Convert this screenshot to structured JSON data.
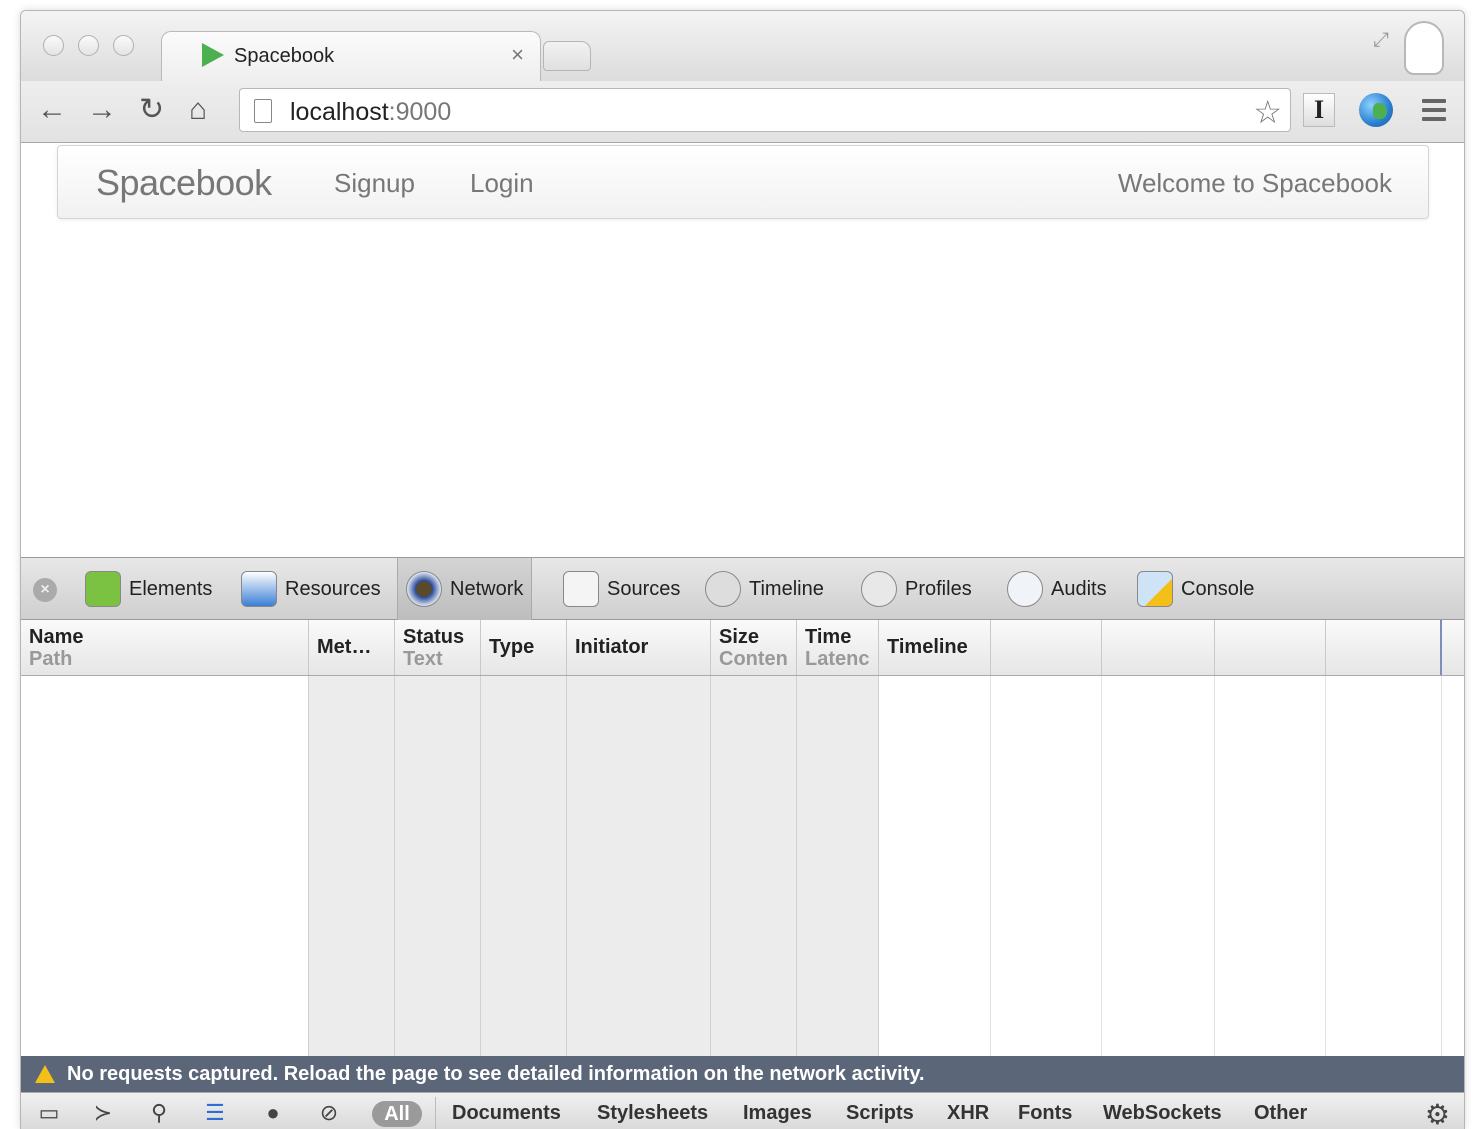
{
  "browser": {
    "tab_title": "Spacebook",
    "tab_close": "×",
    "url_host": "localhost",
    "url_port": ":9000"
  },
  "site": {
    "brand": "Spacebook",
    "nav": [
      "Signup",
      "Login"
    ],
    "welcome": "Welcome to Spacebook"
  },
  "devtools": {
    "tabs": [
      "Elements",
      "Resources",
      "Network",
      "Sources",
      "Timeline",
      "Profiles",
      "Audits",
      "Console"
    ],
    "active_tab": "Network",
    "columns": {
      "name": {
        "title": "Name",
        "sub": "Path"
      },
      "method": {
        "title": "Met…"
      },
      "status": {
        "title": "Status",
        "sub": "Text"
      },
      "type": {
        "title": "Type"
      },
      "initiator": {
        "title": "Initiator"
      },
      "size": {
        "title": "Size",
        "sub": "Conten"
      },
      "time": {
        "title": "Time",
        "sub": "Latenc"
      },
      "timeline": {
        "title": "Timeline"
      }
    },
    "warning": "No requests captured. Reload the page to see detailed information on the network activity.",
    "filter_all": "All",
    "filters": [
      "Documents",
      "Stylesheets",
      "Images",
      "Scripts",
      "XHR",
      "Fonts",
      "WebSockets",
      "Other"
    ]
  }
}
